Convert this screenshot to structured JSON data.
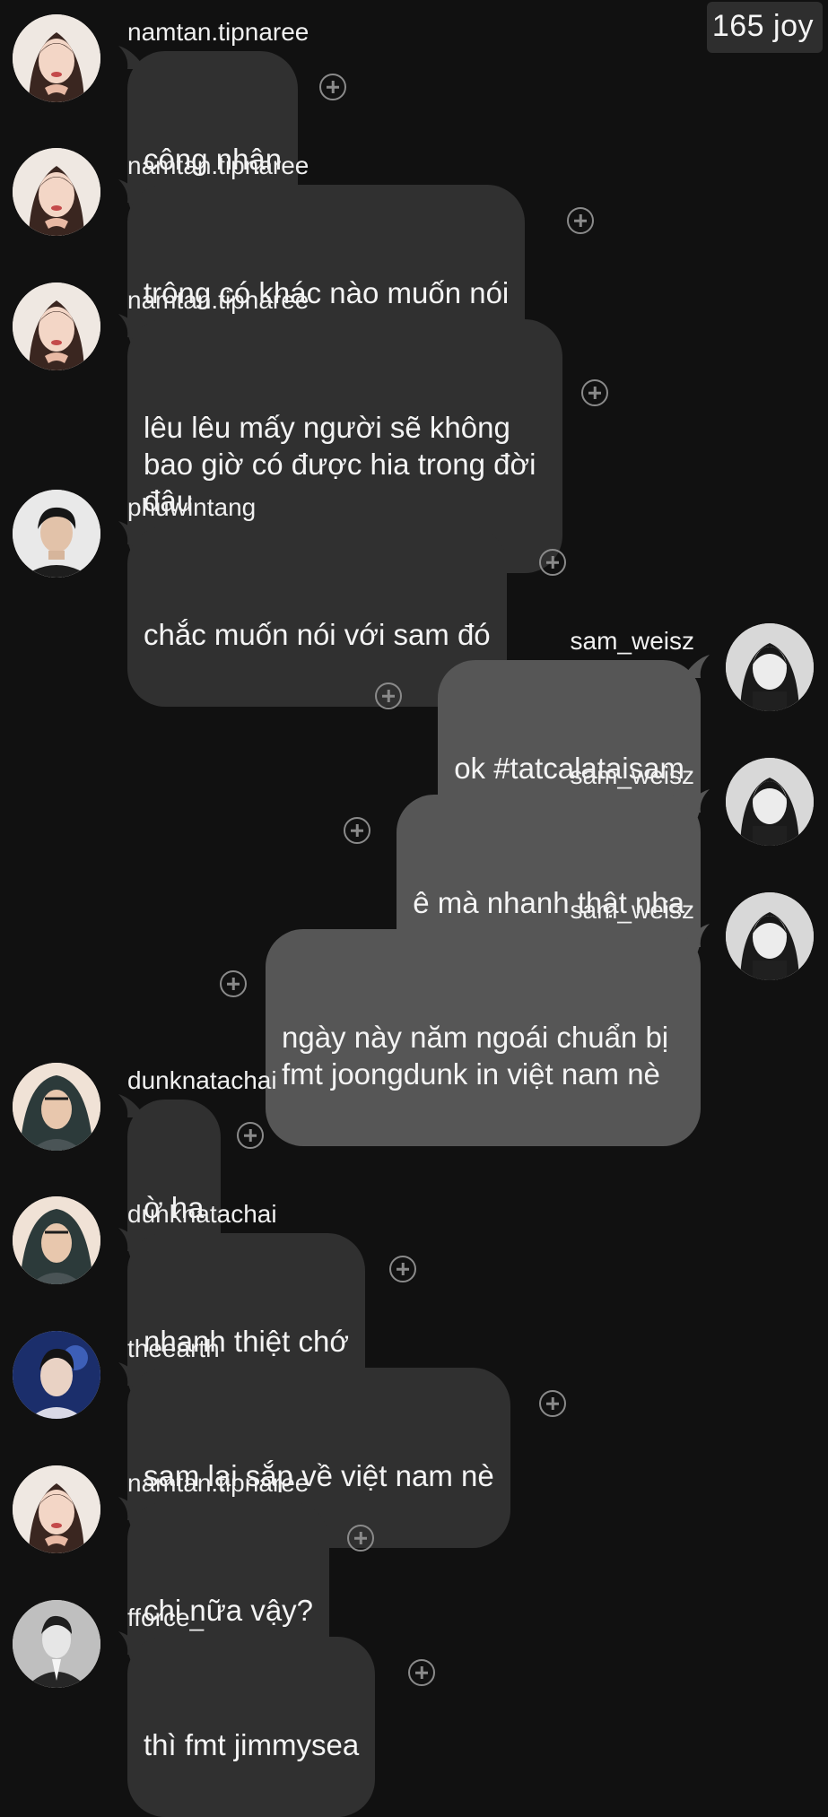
{
  "watermark": "165 joy",
  "colors": {
    "background": "#111111",
    "incoming_bubble": "#303030",
    "outgoing_bubble": "#565656",
    "text": "#f4f4f4",
    "react_icon": "#8a8a8a"
  },
  "messages": [
    {
      "side": "left",
      "username": "namtan.tipnaree",
      "text": "công nhận",
      "avatar_icon": "avatar-woman-icon"
    },
    {
      "side": "left",
      "username": "namtan.tipnaree",
      "text": "trông có khác nào muốn nói",
      "avatar_icon": "avatar-woman-icon"
    },
    {
      "side": "left",
      "username": "namtan.tipnaree",
      "text": "lêu lêu mấy người sẽ không\nbao giờ có được hia trong đời\nđâu",
      "avatar_icon": "avatar-woman-icon"
    },
    {
      "side": "left",
      "username": "phuwintang",
      "text": "chắc muốn nói với sam đó",
      "avatar_icon": "avatar-man-icon"
    },
    {
      "side": "right",
      "username": "sam_weisz",
      "text": "ok #tatcalataisam",
      "avatar_icon": "avatar-woman-bw-icon"
    },
    {
      "side": "right",
      "username": "sam_weisz",
      "text": "ê mà nhanh thật nha",
      "avatar_icon": "avatar-woman-bw-icon"
    },
    {
      "side": "right",
      "username": "sam_weisz",
      "text": "ngày này năm ngoái chuẩn bị\nfmt joongdunk in việt nam nè",
      "avatar_icon": "avatar-woman-bw-icon"
    },
    {
      "side": "left",
      "username": "dunknatachai",
      "text": "ờ ha",
      "avatar_icon": "avatar-man-scarf-icon"
    },
    {
      "side": "left",
      "username": "dunknatachai",
      "text": "nhanh thiệt chớ",
      "avatar_icon": "avatar-man-scarf-icon"
    },
    {
      "side": "left",
      "username": "theearth",
      "text": "sam lại sắp về việt nam nè",
      "avatar_icon": "avatar-man-blue-icon"
    },
    {
      "side": "left",
      "username": "namtan.tipnaree",
      "text": "chi nữa vậy?",
      "avatar_icon": "avatar-woman-icon"
    },
    {
      "side": "left",
      "username": "fforce_",
      "text": "thì fmt jimmysea",
      "avatar_icon": "avatar-man-bw-icon"
    }
  ]
}
